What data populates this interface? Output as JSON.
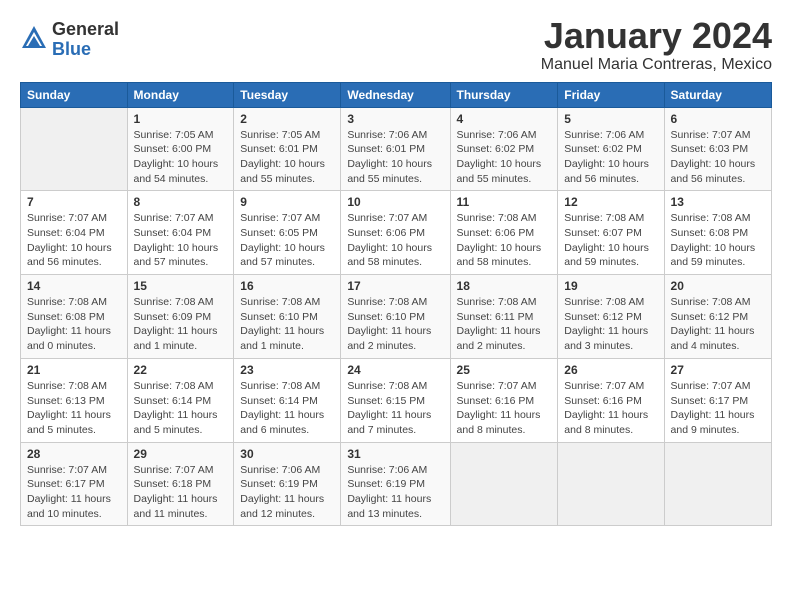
{
  "logo": {
    "general": "General",
    "blue": "Blue"
  },
  "title": "January 2024",
  "location": "Manuel Maria Contreras, Mexico",
  "days_header": [
    "Sunday",
    "Monday",
    "Tuesday",
    "Wednesday",
    "Thursday",
    "Friday",
    "Saturday"
  ],
  "weeks": [
    [
      {
        "num": "",
        "info": ""
      },
      {
        "num": "1",
        "info": "Sunrise: 7:05 AM\nSunset: 6:00 PM\nDaylight: 10 hours\nand 54 minutes."
      },
      {
        "num": "2",
        "info": "Sunrise: 7:05 AM\nSunset: 6:01 PM\nDaylight: 10 hours\nand 55 minutes."
      },
      {
        "num": "3",
        "info": "Sunrise: 7:06 AM\nSunset: 6:01 PM\nDaylight: 10 hours\nand 55 minutes."
      },
      {
        "num": "4",
        "info": "Sunrise: 7:06 AM\nSunset: 6:02 PM\nDaylight: 10 hours\nand 55 minutes."
      },
      {
        "num": "5",
        "info": "Sunrise: 7:06 AM\nSunset: 6:02 PM\nDaylight: 10 hours\nand 56 minutes."
      },
      {
        "num": "6",
        "info": "Sunrise: 7:07 AM\nSunset: 6:03 PM\nDaylight: 10 hours\nand 56 minutes."
      }
    ],
    [
      {
        "num": "7",
        "info": "Sunrise: 7:07 AM\nSunset: 6:04 PM\nDaylight: 10 hours\nand 56 minutes."
      },
      {
        "num": "8",
        "info": "Sunrise: 7:07 AM\nSunset: 6:04 PM\nDaylight: 10 hours\nand 57 minutes."
      },
      {
        "num": "9",
        "info": "Sunrise: 7:07 AM\nSunset: 6:05 PM\nDaylight: 10 hours\nand 57 minutes."
      },
      {
        "num": "10",
        "info": "Sunrise: 7:07 AM\nSunset: 6:06 PM\nDaylight: 10 hours\nand 58 minutes."
      },
      {
        "num": "11",
        "info": "Sunrise: 7:08 AM\nSunset: 6:06 PM\nDaylight: 10 hours\nand 58 minutes."
      },
      {
        "num": "12",
        "info": "Sunrise: 7:08 AM\nSunset: 6:07 PM\nDaylight: 10 hours\nand 59 minutes."
      },
      {
        "num": "13",
        "info": "Sunrise: 7:08 AM\nSunset: 6:08 PM\nDaylight: 10 hours\nand 59 minutes."
      }
    ],
    [
      {
        "num": "14",
        "info": "Sunrise: 7:08 AM\nSunset: 6:08 PM\nDaylight: 11 hours\nand 0 minutes."
      },
      {
        "num": "15",
        "info": "Sunrise: 7:08 AM\nSunset: 6:09 PM\nDaylight: 11 hours\nand 1 minute."
      },
      {
        "num": "16",
        "info": "Sunrise: 7:08 AM\nSunset: 6:10 PM\nDaylight: 11 hours\nand 1 minute."
      },
      {
        "num": "17",
        "info": "Sunrise: 7:08 AM\nSunset: 6:10 PM\nDaylight: 11 hours\nand 2 minutes."
      },
      {
        "num": "18",
        "info": "Sunrise: 7:08 AM\nSunset: 6:11 PM\nDaylight: 11 hours\nand 2 minutes."
      },
      {
        "num": "19",
        "info": "Sunrise: 7:08 AM\nSunset: 6:12 PM\nDaylight: 11 hours\nand 3 minutes."
      },
      {
        "num": "20",
        "info": "Sunrise: 7:08 AM\nSunset: 6:12 PM\nDaylight: 11 hours\nand 4 minutes."
      }
    ],
    [
      {
        "num": "21",
        "info": "Sunrise: 7:08 AM\nSunset: 6:13 PM\nDaylight: 11 hours\nand 5 minutes."
      },
      {
        "num": "22",
        "info": "Sunrise: 7:08 AM\nSunset: 6:14 PM\nDaylight: 11 hours\nand 5 minutes."
      },
      {
        "num": "23",
        "info": "Sunrise: 7:08 AM\nSunset: 6:14 PM\nDaylight: 11 hours\nand 6 minutes."
      },
      {
        "num": "24",
        "info": "Sunrise: 7:08 AM\nSunset: 6:15 PM\nDaylight: 11 hours\nand 7 minutes."
      },
      {
        "num": "25",
        "info": "Sunrise: 7:07 AM\nSunset: 6:16 PM\nDaylight: 11 hours\nand 8 minutes."
      },
      {
        "num": "26",
        "info": "Sunrise: 7:07 AM\nSunset: 6:16 PM\nDaylight: 11 hours\nand 8 minutes."
      },
      {
        "num": "27",
        "info": "Sunrise: 7:07 AM\nSunset: 6:17 PM\nDaylight: 11 hours\nand 9 minutes."
      }
    ],
    [
      {
        "num": "28",
        "info": "Sunrise: 7:07 AM\nSunset: 6:17 PM\nDaylight: 11 hours\nand 10 minutes."
      },
      {
        "num": "29",
        "info": "Sunrise: 7:07 AM\nSunset: 6:18 PM\nDaylight: 11 hours\nand 11 minutes."
      },
      {
        "num": "30",
        "info": "Sunrise: 7:06 AM\nSunset: 6:19 PM\nDaylight: 11 hours\nand 12 minutes."
      },
      {
        "num": "31",
        "info": "Sunrise: 7:06 AM\nSunset: 6:19 PM\nDaylight: 11 hours\nand 13 minutes."
      },
      {
        "num": "",
        "info": ""
      },
      {
        "num": "",
        "info": ""
      },
      {
        "num": "",
        "info": ""
      }
    ]
  ]
}
